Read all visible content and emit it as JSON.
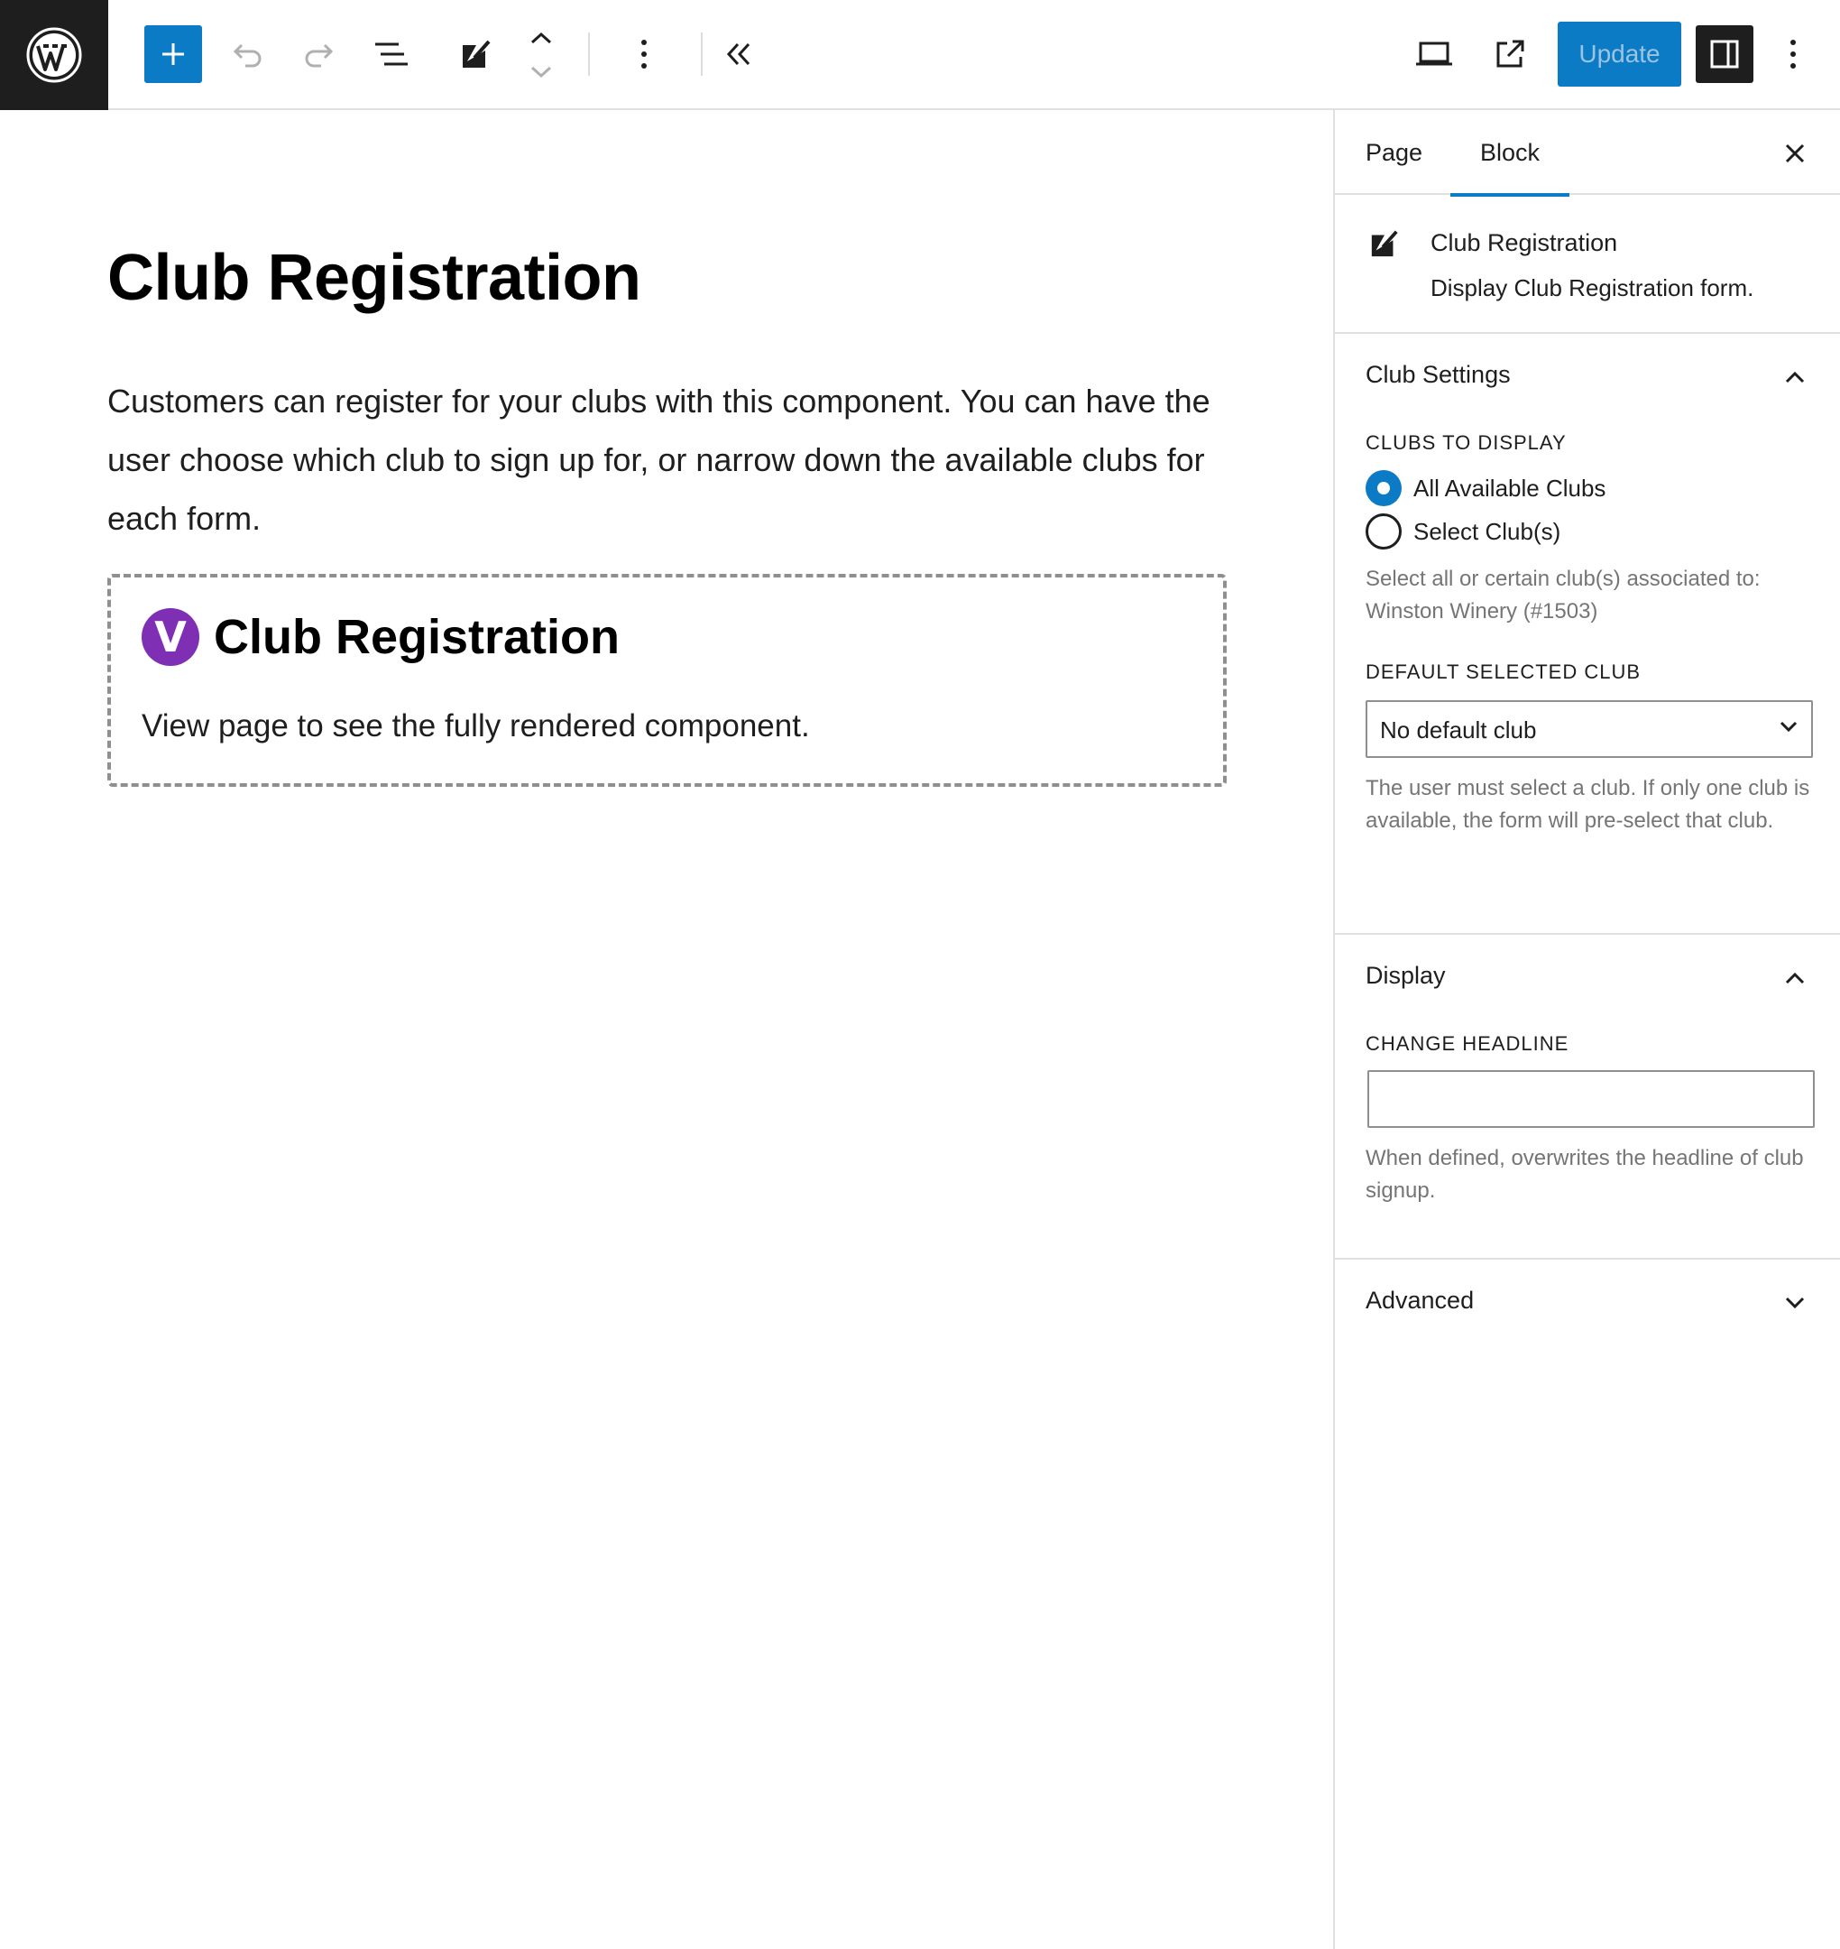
{
  "toolbar": {
    "update_label": "Update"
  },
  "editor": {
    "title": "Club Registration",
    "paragraph": "Customers can register for your clubs with this component. You can have the user choose which club to sign up for, or narrow down the available clubs for each form.",
    "block": {
      "badge_letter": "V",
      "heading": "Club Registration",
      "body": "View page to see the fully rendered component."
    }
  },
  "sidebar": {
    "tabs": [
      {
        "label": "Page",
        "active": false
      },
      {
        "label": "Block",
        "active": true
      }
    ],
    "block_card": {
      "title": "Club Registration",
      "description": "Display Club Registration form."
    },
    "club_settings": {
      "title": "Club Settings",
      "expanded": true,
      "clubs_to_display_label": "Clubs to display",
      "options": [
        {
          "label": "All Available Clubs",
          "checked": true
        },
        {
          "label": "Select Club(s)",
          "checked": false
        }
      ],
      "clubs_help": "Select all or certain club(s) associated to: Winston Winery (#1503)",
      "default_club_label": "Default selected club",
      "default_club_value": "No default club",
      "default_club_help": "The user must select a club. If only one club is available, the form will pre-select that club."
    },
    "display": {
      "title": "Display",
      "expanded": true,
      "headline_label": "Change headline",
      "headline_value": "",
      "headline_help": "When defined, overwrites the headline of club signup."
    },
    "advanced": {
      "title": "Advanced",
      "expanded": false
    }
  },
  "colors": {
    "accent": "#0a7bc4",
    "dark": "#1e1e1e",
    "badge": "#7e2fb3",
    "help_text": "#757575"
  },
  "icons": {
    "logo": "wordpress-logo-icon",
    "add": "plus-icon",
    "undo": "undo-icon",
    "redo": "redo-icon",
    "list_view": "list-view-icon",
    "block_type": "edit-block-icon",
    "move": "move-up-down-icon",
    "options": "more-vertical-icon",
    "collapse": "chevron-double-left-icon",
    "view": "desktop-view-icon",
    "preview_external": "external-link-icon",
    "settings": "sidebar-toggle-icon"
  }
}
